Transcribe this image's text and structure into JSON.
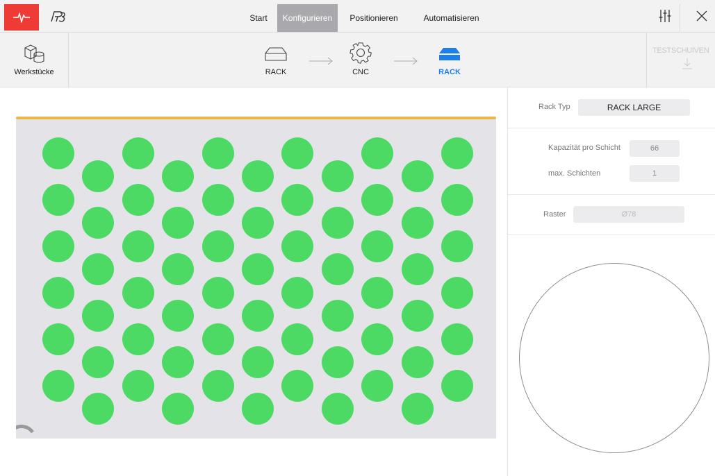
{
  "topbar": {
    "logo_icon": "pulse-icon",
    "brand_icon": "r3-brand-icon",
    "tabs": [
      {
        "label": "Start",
        "active": false
      },
      {
        "label": "Konfigurieren",
        "active": true
      },
      {
        "label": "Positionieren",
        "active": false
      },
      {
        "label": "Automatisieren",
        "active": false
      }
    ],
    "settings_icon": "sliders-icon",
    "close_icon": "close-icon"
  },
  "stepbar": {
    "parts_label": "Werkstücke",
    "steps": [
      {
        "label": "RACK",
        "icon": "rack-icon",
        "active": false
      },
      {
        "label": "CNC",
        "icon": "gear-icon",
        "active": false
      },
      {
        "label": "RACK",
        "icon": "rack-filled-icon",
        "active": true
      }
    ],
    "test_label": "TESTSCHUIVEN",
    "test_icon": "download-arrow-icon"
  },
  "rack": {
    "columns": 11,
    "rows_even": 6,
    "rows_odd": 6,
    "slot_color": "#4cd964",
    "frame_color": "#e8b64a"
  },
  "panel": {
    "rack_type_label": "Rack Typ",
    "rack_type_value": "RACK LARGE",
    "capacity_label": "Kapazität pro Schicht",
    "capacity_value": "66",
    "layers_label": "max. Schichten",
    "layers_value": "1",
    "grid_label": "Raster",
    "grid_value": "Ø78"
  },
  "colors": {
    "accent": "#1f7fe8",
    "brand_red": "#ef3b36",
    "active_tab": "#a9a9ad"
  }
}
